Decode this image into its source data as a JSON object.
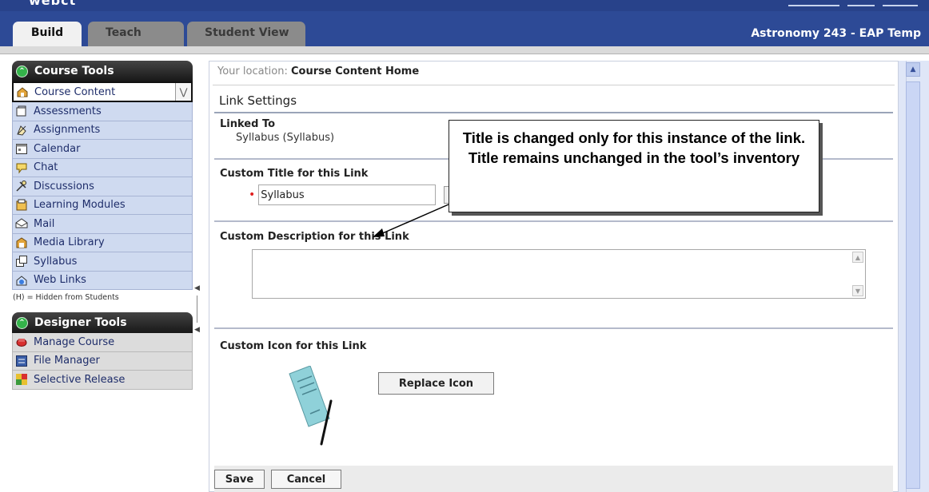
{
  "header": {
    "logo_text": "webct",
    "tabs": [
      {
        "label": "Build"
      },
      {
        "label": "Teach"
      },
      {
        "label": "Student View"
      }
    ],
    "course_title": "Astronomy 243 - EAP Temp"
  },
  "sidebar": {
    "course_tools": {
      "title": "Course Tools",
      "items": [
        {
          "label": "Course Content",
          "icon": "course-content-icon"
        },
        {
          "label": "Assessments",
          "icon": "assessments-icon"
        },
        {
          "label": "Assignments",
          "icon": "assignments-icon"
        },
        {
          "label": "Calendar",
          "icon": "calendar-icon"
        },
        {
          "label": "Chat",
          "icon": "chat-icon"
        },
        {
          "label": "Discussions",
          "icon": "discussions-icon"
        },
        {
          "label": "Learning Modules",
          "icon": "learning-modules-icon"
        },
        {
          "label": "Mail",
          "icon": "mail-icon"
        },
        {
          "label": "Media Library",
          "icon": "media-library-icon"
        },
        {
          "label": "Syllabus",
          "icon": "syllabus-icon"
        },
        {
          "label": "Web Links",
          "icon": "web-links-icon"
        }
      ]
    },
    "hidden_note": "(H) = Hidden from Students",
    "designer_tools": {
      "title": "Designer Tools",
      "items": [
        {
          "label": "Manage Course",
          "icon": "manage-course-icon"
        },
        {
          "label": "File Manager",
          "icon": "file-manager-icon"
        },
        {
          "label": "Selective Release",
          "icon": "selective-release-icon"
        }
      ]
    }
  },
  "main": {
    "location_prefix": "Your location:",
    "location_value": "Course Content Home",
    "section_title": "Link Settings",
    "linked_to_label": "Linked To",
    "linked_to_value": "Syllabus (Syllabus)",
    "custom_title_label": "Custom Title for this Link",
    "custom_title_value": "Syllabus",
    "custom_description_label": "Custom Description for this Link",
    "custom_description_value": "",
    "custom_icon_label": "Custom Icon for this Link",
    "replace_icon_label": "Replace Icon",
    "save_label": "Save",
    "cancel_label": "Cancel"
  },
  "callout": {
    "text": "Title is changed only for this instance of the link. Title remains unchanged in the tool’s inventory"
  },
  "colors": {
    "header_blue": "#2d4a96",
    "nav_item_bg": "#cfdaf0",
    "panel_header": "#222222",
    "required_star": "#e02020",
    "green_circle": "#34b34a"
  }
}
